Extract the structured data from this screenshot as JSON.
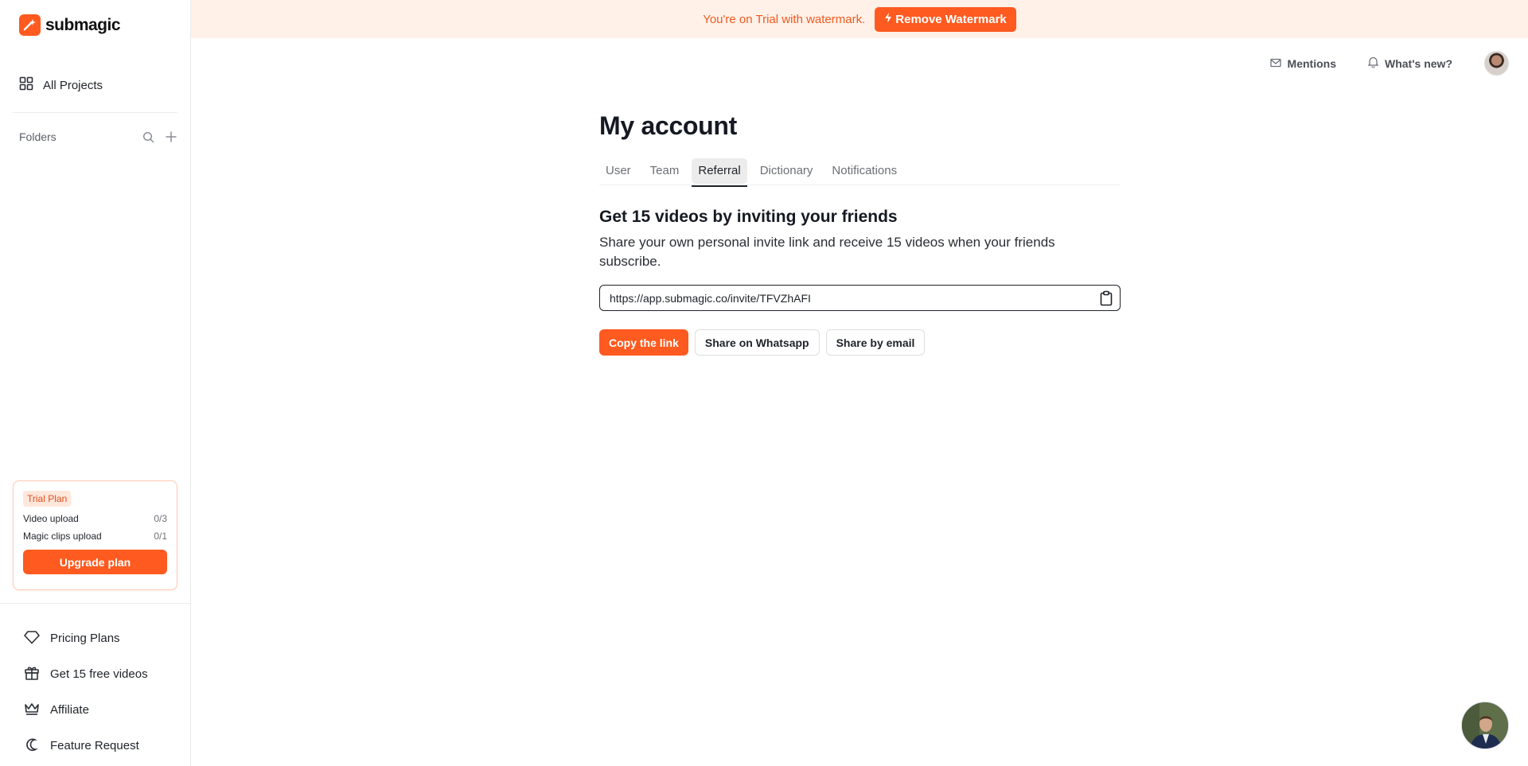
{
  "app": {
    "name": "submagic"
  },
  "banner": {
    "text": "You're on Trial with watermark.",
    "button_label": "Remove Watermark"
  },
  "sidebar": {
    "all_projects": "All Projects",
    "folders_label": "Folders",
    "trial": {
      "badge": "Trial Plan",
      "rows": [
        {
          "label": "Video upload",
          "value": "0/3"
        },
        {
          "label": "Magic clips upload",
          "value": "0/1"
        }
      ],
      "upgrade_label": "Upgrade plan"
    },
    "bottom_items": [
      {
        "label": "Pricing Plans",
        "icon": "diamond-icon"
      },
      {
        "label": "Get 15 free videos",
        "icon": "gift-icon"
      },
      {
        "label": "Affiliate",
        "icon": "crown-icon"
      },
      {
        "label": "Feature Request",
        "icon": "moon-icon"
      }
    ]
  },
  "topbar": {
    "mentions": "Mentions",
    "whats_new": "What's new?"
  },
  "main": {
    "title": "My account",
    "tabs": [
      {
        "label": "User",
        "active": false
      },
      {
        "label": "Team",
        "active": false
      },
      {
        "label": "Referral",
        "active": true
      },
      {
        "label": "Dictionary",
        "active": false
      },
      {
        "label": "Notifications",
        "active": false
      }
    ],
    "referral": {
      "title": "Get 15 videos by inviting your friends",
      "description": "Share your own personal invite link and receive 15 videos when your friends subscribe.",
      "invite_link": "https://app.submagic.co/invite/TFVZhAFI",
      "copy_label": "Copy the link",
      "whatsapp_label": "Share on Whatsapp",
      "email_label": "Share by email"
    }
  },
  "colors": {
    "accent": "#ff5a1f",
    "banner_bg": "#fff1e8"
  }
}
